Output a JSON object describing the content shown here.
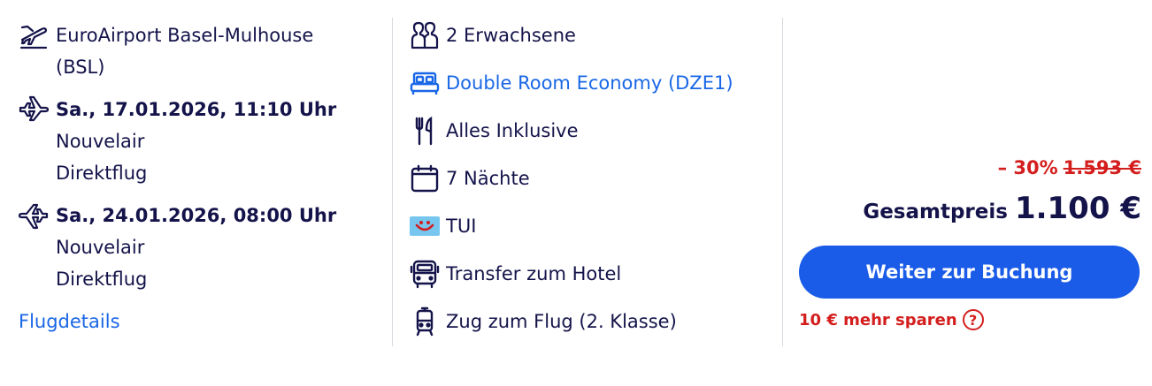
{
  "departure_airport": {
    "icon": "airport-departure-icon",
    "line1": "EuroAirport Basel-Mulhouse",
    "line2": "(BSL)"
  },
  "outbound_flight": {
    "icon": "plane-outbound-icon",
    "datetime": "Sa., 17.01.2026, 11:10 Uhr",
    "airline": "Nouvelair",
    "type": "Direktflug"
  },
  "return_flight": {
    "icon": "plane-return-icon",
    "datetime": "Sa., 24.01.2026, 08:00 Uhr",
    "airline": "Nouvelair",
    "type": "Direktflug"
  },
  "flight_details_link": "Flugdetails",
  "features": {
    "travellers": "2 Erwachsene",
    "room": "Double Room Economy (DZE1)",
    "board": "Alles Inklusive",
    "nights": "7 Nächte",
    "operator": "TUI",
    "transfer": "Transfer zum Hotel",
    "train": "Zug zum Flug (2. Klasse)"
  },
  "pricing": {
    "discount": "– 30%",
    "old_price": "1.593 €",
    "total_label": "Gesamtpreis",
    "total_price": "1.100 €",
    "cta_label": "Weiter zur Buchung",
    "save_more": "10 € mehr sparen",
    "help_glyph": "?"
  },
  "colors": {
    "navy": "#14134a",
    "link_blue": "#1967e6",
    "button_blue": "#1a5be8",
    "red": "#d41e1e",
    "tui_badge": "#77c6ef"
  }
}
